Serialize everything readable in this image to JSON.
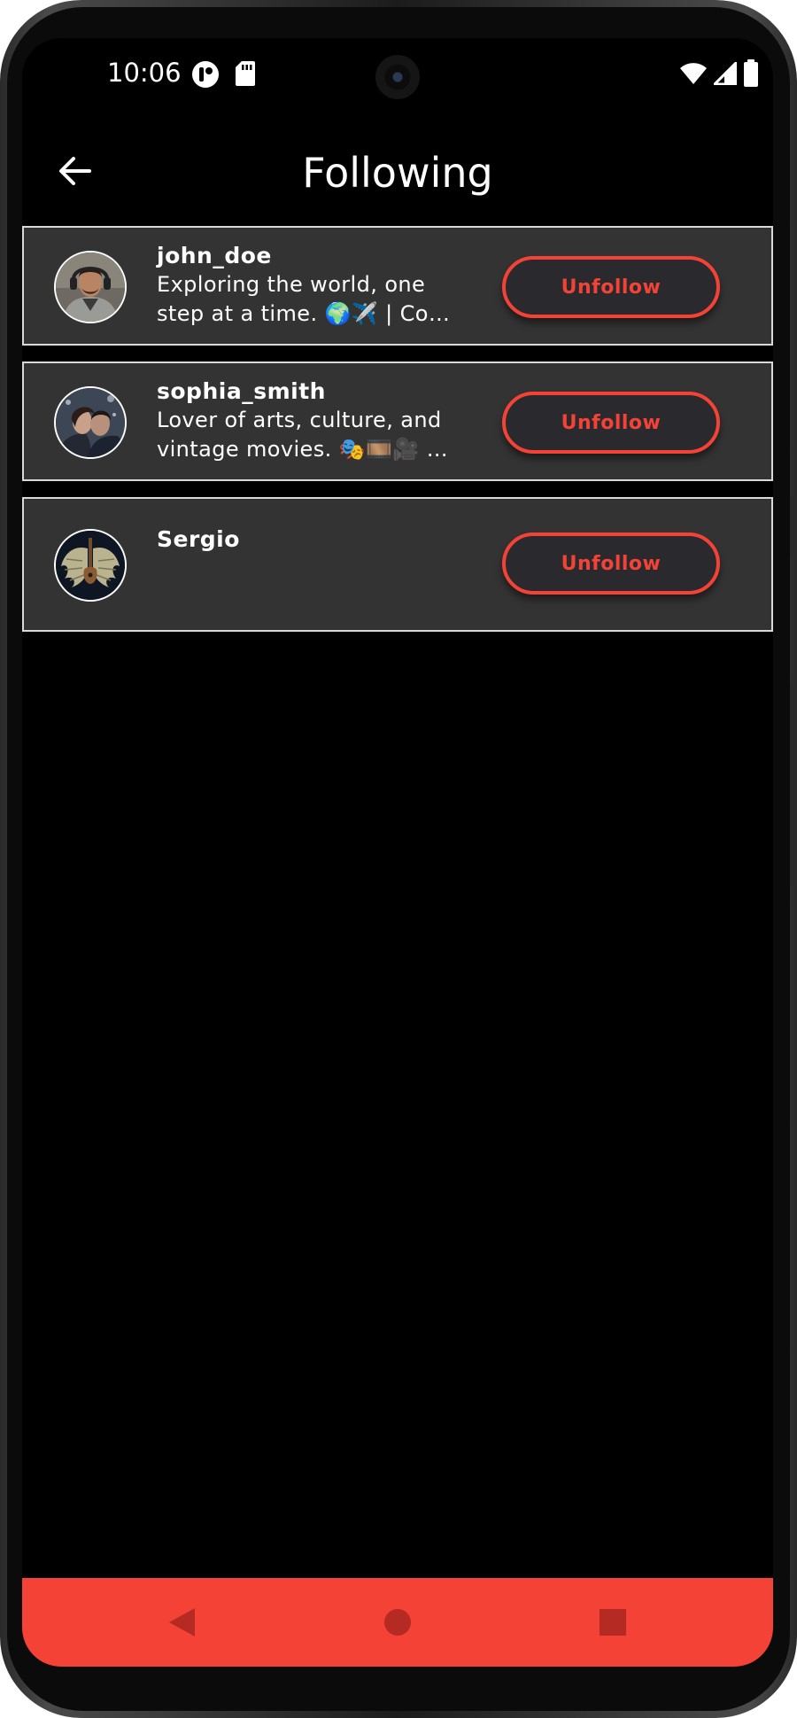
{
  "status_bar": {
    "time": "10:06",
    "left_icons": [
      "app-notification-icon",
      "sd-card-icon"
    ],
    "right_icons": [
      "wifi-icon",
      "signal-icon",
      "battery-icon"
    ]
  },
  "app_bar": {
    "title": "Following",
    "back_icon": "arrow-left-icon"
  },
  "following": [
    {
      "username": "john_doe",
      "bio_line1": "Exploring the world, one",
      "bio_line2": "step at a time. 🌍✈️ | Co…",
      "button_label": "Unfollow"
    },
    {
      "username": "sophia_smith",
      "bio_line1": "Lover of arts, culture, and",
      "bio_line2": "vintage movies. 🎭🎞️🎥 …",
      "button_label": "Unfollow"
    },
    {
      "username": "Sergio",
      "bio_line1": "",
      "bio_line2": "",
      "button_label": "Unfollow"
    }
  ],
  "nav_bar": {
    "icons": [
      "back-triangle-icon",
      "home-circle-icon",
      "recents-square-icon"
    ]
  },
  "colors": {
    "accent": "#f44336",
    "card_background": "#333333",
    "screen_background": "#000000",
    "button_background": "#2a2a2e"
  }
}
